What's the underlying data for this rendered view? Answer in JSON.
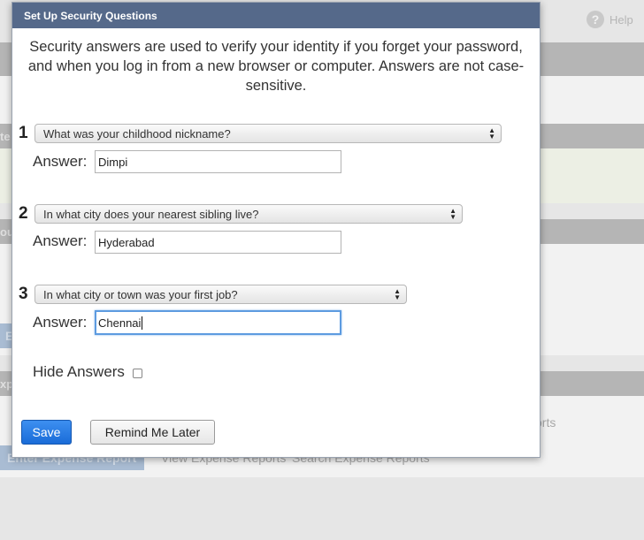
{
  "background": {
    "help_label": "Help",
    "help_glyph": "?",
    "fragment_1": "te",
    "fragment_2": "ou",
    "fragment_3": "E",
    "fragment_4": "xp",
    "fragment_5": "s",
    "fragment_6": "orts",
    "enter_report_button": "Enter Expense Report",
    "view_reports_link": "View Expense Reports",
    "search_reports_link": "Search Expense Reports"
  },
  "modal": {
    "title": "Set Up Security Questions",
    "intro": "Security answers are used to verify your identity if you forget your password, and when you log in from a new browser or computer. Answers are not case-sensitive.",
    "answer_label": "Answer:",
    "questions": [
      {
        "number": "1",
        "question": "What was your childhood nickname?",
        "answer": "Dimpi"
      },
      {
        "number": "2",
        "question": "In what city does your nearest sibling live?",
        "answer": "Hyderabad"
      },
      {
        "number": "3",
        "question": "In what city or town was your first job?",
        "answer": "Chennai"
      }
    ],
    "hide_answers_label": "Hide Answers",
    "hide_answers_checked": false,
    "save_button": "Save",
    "remind_button": "Remind Me Later"
  },
  "colors": {
    "header_bg": "#55698a",
    "save_button_bg": "#1a6cd8",
    "focus_ring": "#5d9be0"
  }
}
